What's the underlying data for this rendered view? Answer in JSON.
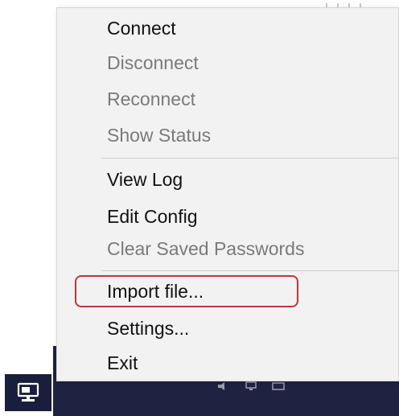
{
  "menu": {
    "items": [
      {
        "label": "Connect",
        "enabled": true
      },
      {
        "label": "Disconnect",
        "enabled": false
      },
      {
        "label": "Reconnect",
        "enabled": false
      },
      {
        "label": "Show Status",
        "enabled": false
      },
      {
        "label": "View Log",
        "enabled": true
      },
      {
        "label": "Edit Config",
        "enabled": true
      },
      {
        "label": "Clear Saved Passwords",
        "enabled": false
      },
      {
        "label": "Import file...",
        "enabled": true,
        "highlighted": true
      },
      {
        "label": "Settings...",
        "enabled": true
      },
      {
        "label": "Exit",
        "enabled": true
      }
    ]
  },
  "colors": {
    "menu_background": "#f2f2f2",
    "enabled_text": "#111111",
    "disabled_text": "#7a7a7a",
    "highlight_outline": "#c0363a",
    "taskbar": "#1f2342"
  },
  "tray": {
    "app_icon": "openvpn-network-icon"
  }
}
